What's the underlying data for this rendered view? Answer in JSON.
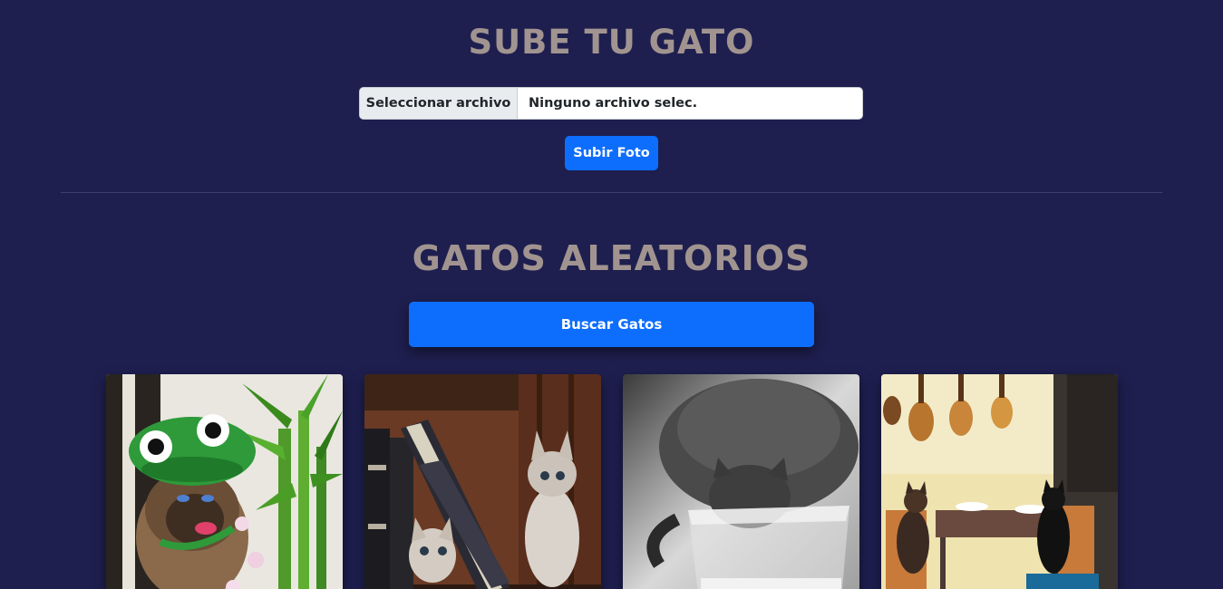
{
  "upload_section": {
    "title": "SUBE TU GATO",
    "file_button_label": "Seleccionar archivo",
    "file_name": "Ninguno archivo selec.",
    "submit_label": "Subir Foto"
  },
  "random_section": {
    "title": "GATOS ALEATORIOS",
    "search_label": "Buscar Gatos"
  },
  "cat_photos": [
    {
      "subject": "cat-in-frog-hat"
    },
    {
      "subject": "kittens-with-books"
    },
    {
      "subject": "cat-drinking-milk"
    },
    {
      "subject": "cats-at-table"
    }
  ],
  "colors": {
    "background": "#1e1f4f",
    "heading": "#a19490",
    "accent": "#0d6efd"
  }
}
